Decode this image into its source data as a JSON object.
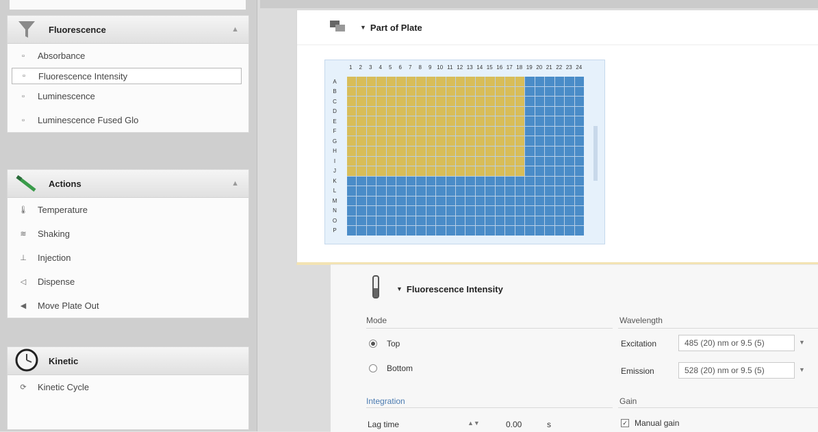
{
  "sidebar": {
    "groups": [
      {
        "title": "Fluorescence",
        "icon": "filter-icon",
        "items": [
          {
            "label": "Absorbance",
            "icon": "square-icon"
          },
          {
            "label": "Fluorescence Intensity",
            "icon": "square-icon",
            "selected": true
          },
          {
            "label": "Luminescence",
            "icon": "square-icon"
          },
          {
            "label": "Luminescence Fused Glo",
            "icon": "square-icon"
          }
        ]
      },
      {
        "title": "Actions",
        "icon": "wand-icon",
        "items": [
          {
            "label": "Temperature",
            "icon": "thermometer-icon"
          },
          {
            "label": "Shaking",
            "icon": "shake-icon"
          },
          {
            "label": "Injection",
            "icon": "injector-icon"
          },
          {
            "label": "Dispense",
            "icon": "dispense-icon"
          },
          {
            "label": "Move Plate Out",
            "icon": "plate-out-icon"
          }
        ]
      },
      {
        "title": "Kinetic",
        "icon": "kinetic-clock-icon",
        "items": [
          {
            "label": "Kinetic Cycle",
            "icon": "cycle-icon"
          }
        ]
      }
    ]
  },
  "plate_card": {
    "title": "Part of Plate",
    "collapse_icon": "triangle-down-icon",
    "icon": "plate-icon",
    "columns": [
      "1",
      "2",
      "3",
      "4",
      "5",
      "6",
      "7",
      "8",
      "9",
      "10",
      "11",
      "12",
      "13",
      "14",
      "15",
      "16",
      "17",
      "18",
      "19",
      "20",
      "21",
      "22",
      "23",
      "24"
    ],
    "rows": [
      "A",
      "B",
      "C",
      "D",
      "E",
      "F",
      "G",
      "H",
      "I",
      "J",
      "K",
      "L",
      "M",
      "N",
      "O",
      "P"
    ],
    "filled_rows": 10,
    "filled_cols": 18,
    "colors": {
      "filled": "#d8bd58",
      "empty": "#4a8cc8"
    }
  },
  "fi_card": {
    "title": "Fluorescence Intensity",
    "collapse_icon": "triangle-down-icon",
    "icon": "test-tube-icon",
    "mode_label": "Mode",
    "mode_options": [
      {
        "label": "Top",
        "selected": true
      },
      {
        "label": "Bottom",
        "selected": false
      }
    ],
    "wavelength_label": "Wavelength",
    "excitation_label": "Excitation",
    "excitation_value": "485 (20) nm or 9.5 (5)",
    "emission_label": "Emission",
    "emission_value": "528 (20) nm or 9.5 (5)",
    "integration_label": "Integration",
    "lag_label": "Lag time",
    "lag_value": "0.00",
    "lag_unit": "s",
    "gain_label": "Gain",
    "gain_option": "Manual gain"
  }
}
